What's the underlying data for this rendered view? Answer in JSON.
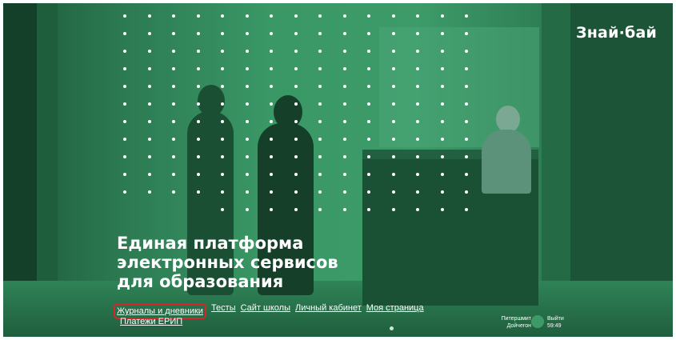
{
  "brand": {
    "logo_text": "Знай·бай"
  },
  "hero": {
    "headline_lines": [
      "Единая платформа",
      "электронных сервисов",
      "для образования"
    ]
  },
  "nav": {
    "items": [
      "Журналы и дневники",
      "Тесты",
      "Сайт школы",
      "Личный кабинет",
      "Моя страница"
    ],
    "second_row_item": "Платежи ЕРИП",
    "highlighted_item": "Журналы и дневники"
  },
  "user": {
    "first_name": "Питершмит",
    "last_name": "Дойчегон",
    "logout_label": "Выйти",
    "session_timer": "59:49"
  },
  "colors": {
    "brand_green": "#3d9b69",
    "highlight_border": "#d9232d",
    "text": "#ffffff"
  }
}
